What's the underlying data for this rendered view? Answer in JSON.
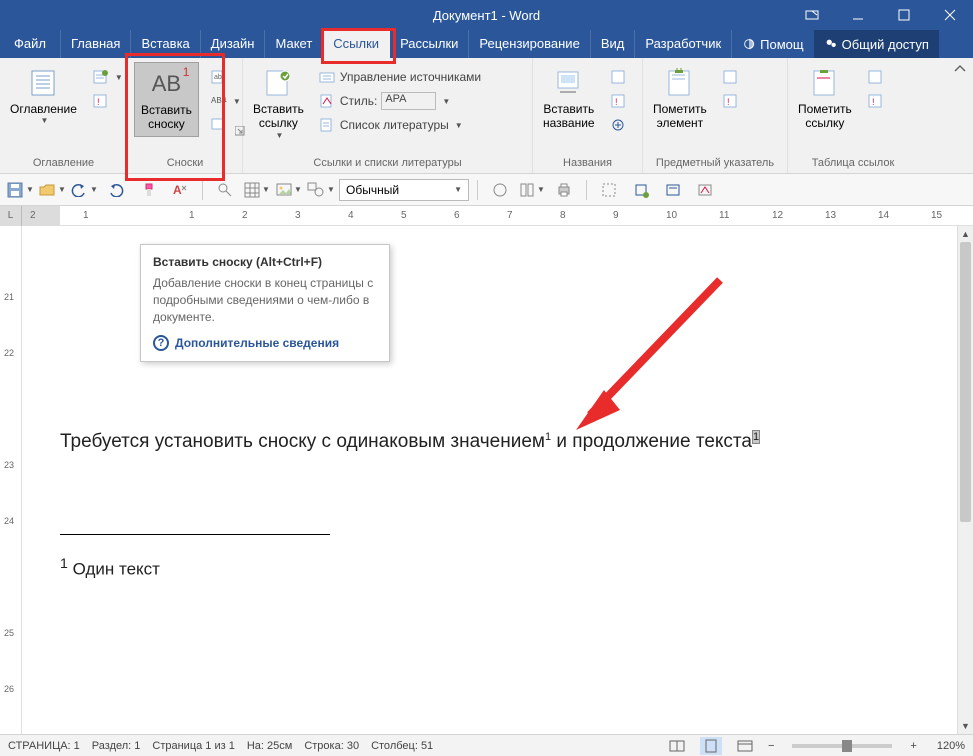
{
  "title": "Документ1 - Word",
  "tabs": {
    "file": "Файл",
    "home": "Главная",
    "insert": "Вставка",
    "design": "Дизайн",
    "layout": "Макет",
    "references": "Ссылки",
    "mailings": "Рассылки",
    "review": "Рецензирование",
    "view": "Вид",
    "developer": "Разработчик",
    "help": "Помощ",
    "share": "Общий доступ"
  },
  "ribbon": {
    "toc_group": {
      "btn": "Оглавление",
      "label": "Оглавление"
    },
    "footnotes_group": {
      "insert_footnote": "Вставить\nсноску",
      "ab": "AB",
      "label": "Сноски"
    },
    "citations_group": {
      "insert_citation": "Вставить\nссылку",
      "manage_sources": "Управление источниками",
      "style_label": "Стиль:",
      "style_value": "APA",
      "bibliography": "Список литературы",
      "label": "Ссылки и списки литературы"
    },
    "captions_group": {
      "insert_caption": "Вставить\nназвание",
      "label": "Названия"
    },
    "index_group": {
      "mark_entry": "Пометить\nэлемент",
      "label": "Предметный указатель"
    },
    "toa_group": {
      "mark_citation": "Пометить\nссылку",
      "label": "Таблица ссылок"
    }
  },
  "qat": {
    "style_combo": "Обычный"
  },
  "tooltip": {
    "title": "Вставить сноску (Alt+Ctrl+F)",
    "desc": "Добавление сноски в конец страницы с подробными сведениями о чем-либо в документе.",
    "link": "Дополнительные сведения"
  },
  "document": {
    "line_pre": "Требуется установить сноску с одинаковым значением",
    "sup1": "1",
    "line_mid": " и продолжение текста",
    "sup2": "1",
    "footnote_num": "1",
    "footnote_text": " Один текст"
  },
  "ruler_numbers": [
    "2",
    "1",
    "",
    "1",
    "2",
    "3",
    "4",
    "5",
    "6",
    "7",
    "8",
    "9",
    "10",
    "11",
    "12",
    "13",
    "14",
    "15"
  ],
  "vruler_numbers": [
    "",
    "21",
    "22",
    "",
    "23",
    "24",
    "",
    "25",
    "26"
  ],
  "status": {
    "page": "СТРАНИЦА: 1",
    "section": "Раздел: 1",
    "page_of": "Страница 1 из 1",
    "at": "На: 25см",
    "line": "Строка: 30",
    "col": "Столбец: 51",
    "zoom": "120%",
    "plus": "+"
  }
}
